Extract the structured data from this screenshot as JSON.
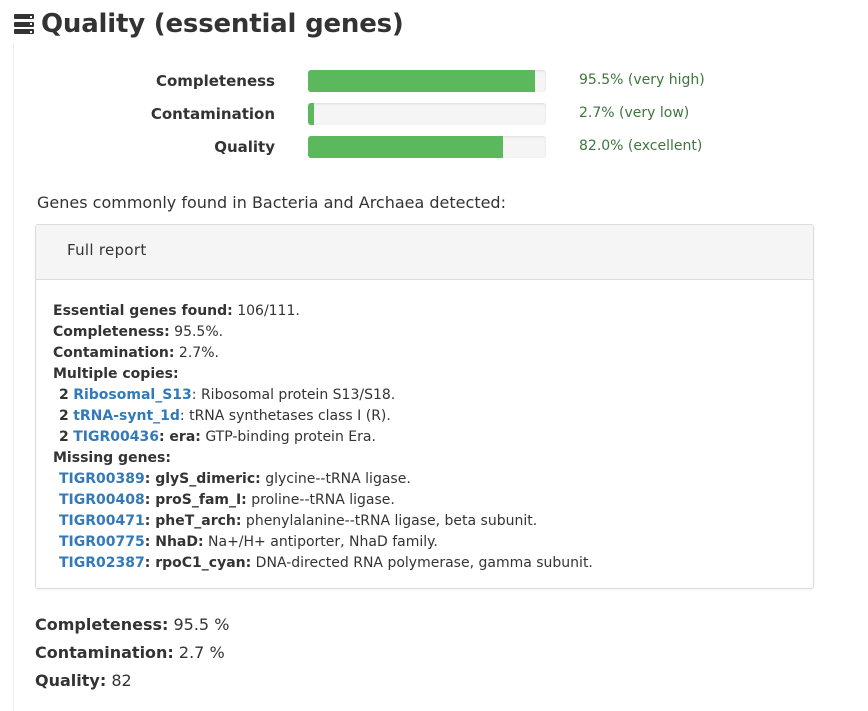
{
  "header": {
    "title": "Quality (essential genes)",
    "icon": "server-stack-icon"
  },
  "metrics": [
    {
      "label": "Completeness",
      "value_text": "95.5% (very high)",
      "fraction": 0.955
    },
    {
      "label": "Contamination",
      "value_text": "2.7% (very low)",
      "fraction": 0.027
    },
    {
      "label": "Quality",
      "value_text": "82.0% (excellent)",
      "fraction": 0.82
    }
  ],
  "colors": {
    "bar": "#5cb85c",
    "value_text": "#3c763d",
    "link": "#337ab7"
  },
  "genes_heading": "Genes commonly found in Bacteria and Archaea detected:",
  "report": {
    "title": "Full report",
    "essential_label": "Essential genes found:",
    "essential_value": " 106/111.",
    "completeness_label": "Completeness:",
    "completeness_value": " 95.5%.",
    "contamination_label": "Contamination:",
    "contamination_value": " 2.7%.",
    "multiple_label": "Multiple copies:",
    "multiple": [
      {
        "count": "2",
        "id": "Ribosomal_S13",
        "name": "",
        "desc": ": Ribosomal protein S13/S18."
      },
      {
        "count": "2",
        "id": "tRNA-synt_1d",
        "name": "",
        "desc": ": tRNA synthetases class I (R)."
      },
      {
        "count": "2",
        "id": "TIGR00436",
        "name": ": era:",
        "desc": " GTP-binding protein Era."
      }
    ],
    "missing_label": "Missing genes:",
    "missing": [
      {
        "id": "TIGR00389",
        "name": ": glyS_dimeric:",
        "desc": " glycine--tRNA ligase."
      },
      {
        "id": "TIGR00408",
        "name": ": proS_fam_I:",
        "desc": " proline--tRNA ligase."
      },
      {
        "id": "TIGR00471",
        "name": ": pheT_arch:",
        "desc": " phenylalanine--tRNA ligase, beta subunit."
      },
      {
        "id": "TIGR00775",
        "name": ": NhaD:",
        "desc": " Na+/H+ antiporter, NhaD family."
      },
      {
        "id": "TIGR02387",
        "name": ": rpoC1_cyan:",
        "desc": " DNA-directed RNA polymerase, gamma subunit."
      }
    ]
  },
  "summary": {
    "completeness_label": "Completeness:",
    "completeness_value": " 95.5 %",
    "contamination_label": "Contamination:",
    "contamination_value": " 2.7 %",
    "quality_label": "Quality:",
    "quality_value": " 82"
  }
}
